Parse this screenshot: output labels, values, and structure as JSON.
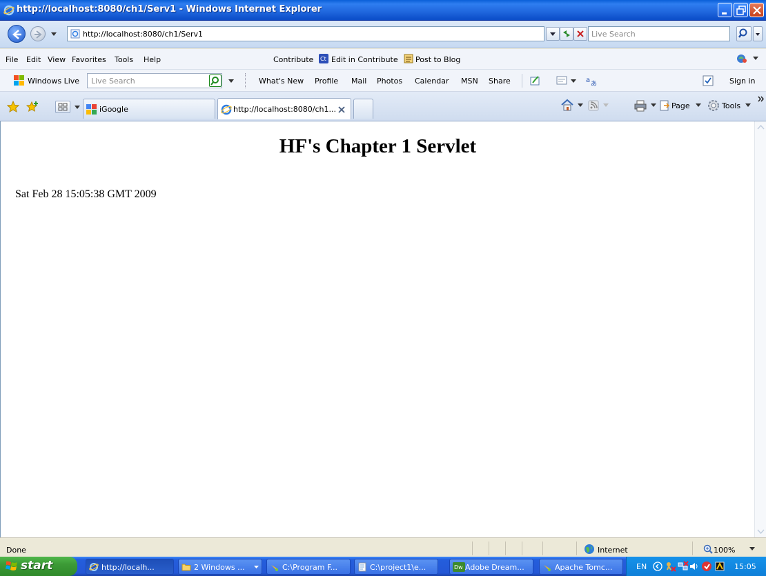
{
  "window": {
    "title": "http://localhost:8080/ch1/Serv1 - Windows Internet Explorer"
  },
  "address_bar": {
    "url": "http://localhost:8080/ch1/Serv1",
    "search_placeholder": "Live Search"
  },
  "menu": [
    "File",
    "Edit",
    "View",
    "Favorites",
    "Tools",
    "Help"
  ],
  "contribute_bar": {
    "contribute": "Contribute",
    "edit_in_contribute": "Edit in Contribute",
    "post_to_blog": "Post to Blog"
  },
  "live_toolbar": {
    "brand": "Windows Live",
    "search_placeholder": "Live Search",
    "links": [
      "What's New",
      "Profile",
      "Mail",
      "Photos",
      "Calendar",
      "MSN",
      "Share"
    ],
    "sign_in": "Sign in"
  },
  "tabs": {
    "igoogle": "iGoogle",
    "active_tab": "http://localhost:8080/ch1...",
    "page_menu": "Page",
    "tools_menu": "Tools"
  },
  "page": {
    "heading": "HF's Chapter 1 Servlet",
    "date": "Sat Feb 28 15:05:38 GMT 2009"
  },
  "status": {
    "text": "Done",
    "zone": "Internet",
    "zoom": "100%"
  },
  "taskbar": {
    "start": "start",
    "tasks": [
      "http://localh...",
      "2 Windows ...",
      "C:\\Program F...",
      "C:\\project1\\e...",
      "Adobe Dream...",
      "Apache Tomc..."
    ],
    "language": "EN",
    "clock": "15:05"
  },
  "colors": {
    "title_bar": "#1f66dd",
    "taskbar": "#2457d6",
    "start_button": "#3c9a36",
    "tray": "#0f7fd8"
  }
}
